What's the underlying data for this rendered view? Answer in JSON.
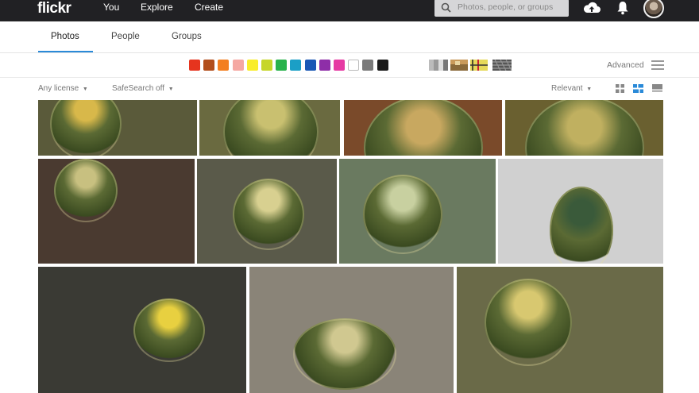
{
  "topbar": {
    "logo": "flickr",
    "nav": [
      "You",
      "Explore",
      "Create"
    ],
    "search_placeholder": "Photos, people, or groups",
    "icons": [
      "upload-cloud-icon",
      "bell-icon",
      "avatar"
    ]
  },
  "subnav": {
    "tabs": [
      "Photos",
      "People",
      "Groups"
    ],
    "active": "Photos"
  },
  "colors": [
    "#e6341e",
    "#b24d1a",
    "#f37f1f",
    "#f5a8a2",
    "#f9ed29",
    "#c6d629",
    "#28b24b",
    "#1b9fc6",
    "#1a58b5",
    "#8e2ea8",
    "#e63aa3",
    "#ffffff",
    "#7a7a7a",
    "#1a1a1a"
  ],
  "advanced_label": "Advanced",
  "filters": {
    "license": "Any license",
    "safesearch": "SafeSearch off",
    "sort": "Relevant"
  },
  "photos_alt": "Golden barrel cactus search results"
}
